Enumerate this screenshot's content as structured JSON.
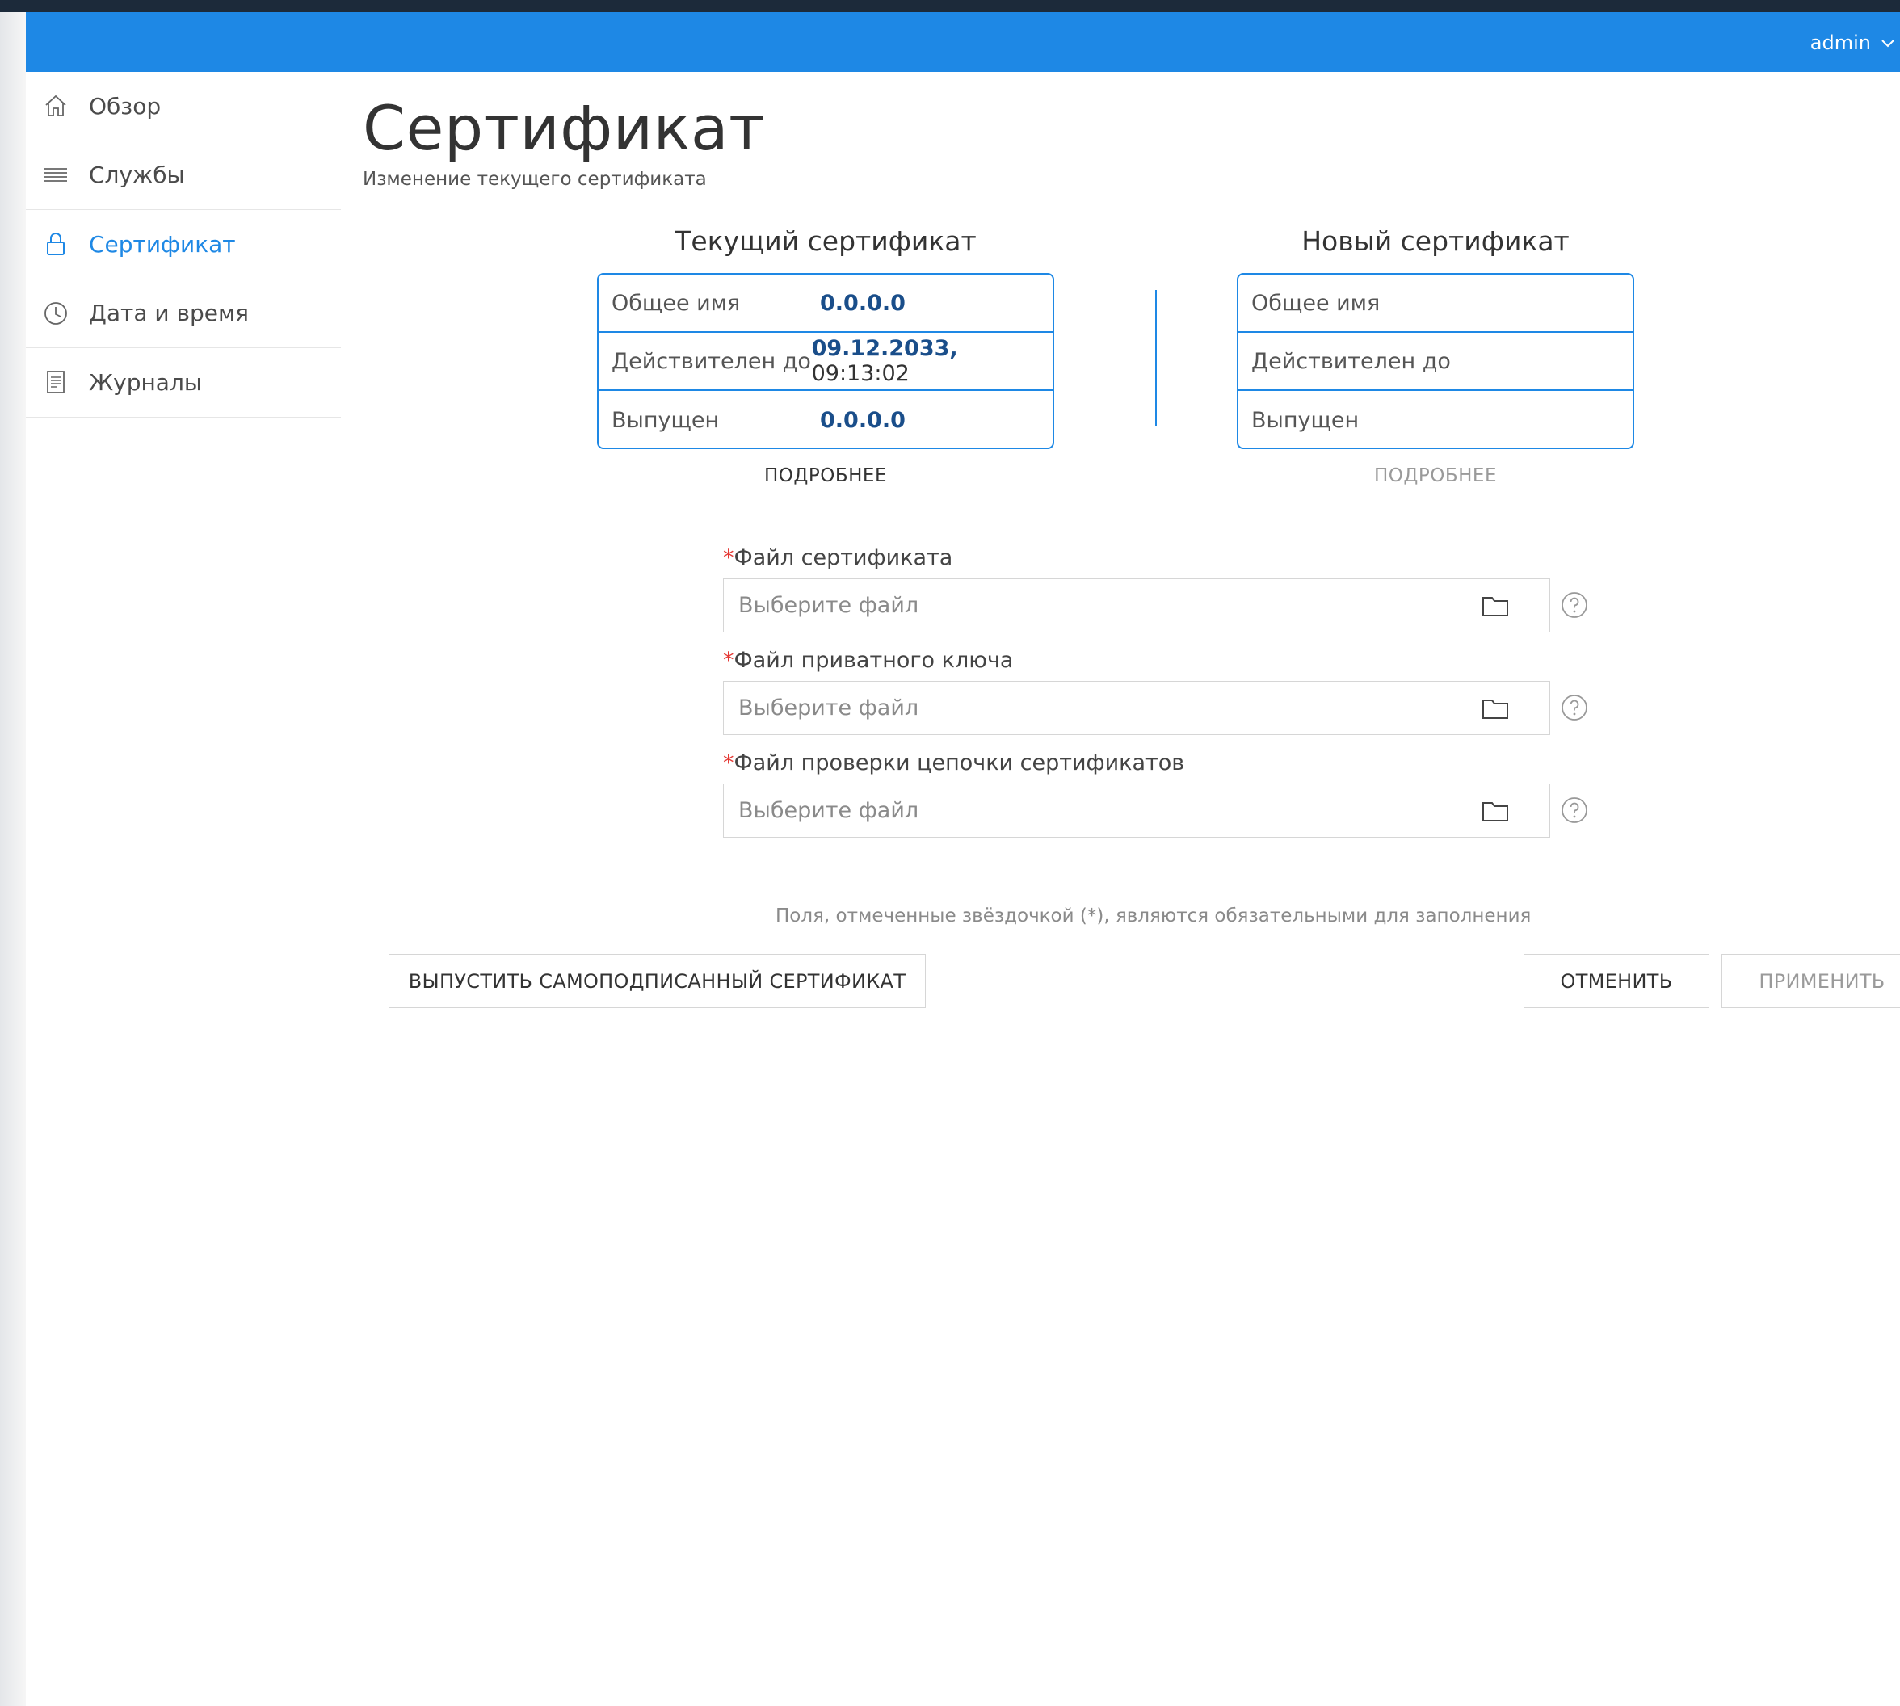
{
  "header": {
    "user": "admin"
  },
  "sidebar": {
    "items": [
      {
        "label": "Обзор",
        "icon": "home-icon"
      },
      {
        "label": "Службы",
        "icon": "list-icon"
      },
      {
        "label": "Сертификат",
        "icon": "lock-icon",
        "active": true
      },
      {
        "label": "Дата и время",
        "icon": "clock-icon"
      },
      {
        "label": "Журналы",
        "icon": "document-icon"
      }
    ]
  },
  "page": {
    "title": "Сертификат",
    "subtitle": "Изменение текущего сертификата"
  },
  "current_cert": {
    "title": "Текущий сертификат",
    "rows": [
      {
        "label": "Общее имя",
        "value": "0.0.0.0"
      },
      {
        "label": "Действителен до",
        "value_date": "09.12.2033,",
        "value_time": " 09:13:02"
      },
      {
        "label": "Выпущен",
        "value": "0.0.0.0"
      }
    ],
    "details": "ПОДРОБНЕЕ"
  },
  "new_cert": {
    "title": "Новый сертификат",
    "rows": [
      {
        "label": "Общее имя"
      },
      {
        "label": "Действителен до"
      },
      {
        "label": "Выпущен"
      }
    ],
    "details": "ПОДРОБНЕЕ"
  },
  "form": {
    "required_mark": "*",
    "fields": [
      {
        "label": "Файл сертификата",
        "placeholder": "Выберите файл"
      },
      {
        "label": "Файл приватного ключа",
        "placeholder": "Выберите файл"
      },
      {
        "label": "Файл проверки цепочки сертификатов",
        "placeholder": "Выберите файл"
      }
    ],
    "hint": "Поля, отмеченные звёздочкой (*), являются обязательными для заполнения"
  },
  "actions": {
    "self_signed": "ВЫПУСТИТЬ САМОПОДПИСАННЫЙ СЕРТИФИКАТ",
    "cancel": "ОТМЕНИТЬ",
    "apply": "ПРИМЕНИТЬ"
  },
  "colors": {
    "accent": "#1e88e5",
    "required": "#e53935",
    "value_text": "#1a4e8a"
  }
}
